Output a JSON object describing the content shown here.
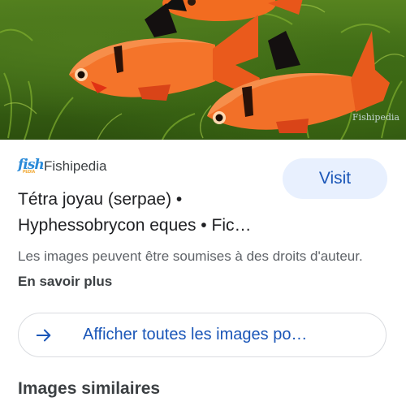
{
  "hero_image": {
    "subject": "tetra-fish-photo",
    "watermark": "Fishipedia"
  },
  "source": {
    "logo_text": "fish",
    "logo_subtext": "PEDIA",
    "name": "Fishipedia"
  },
  "visit_button": {
    "label": "Visit"
  },
  "result": {
    "title_line1": "Tétra joyau (serpae) •",
    "title_line2": "Hyphessobrycon eques • Fic…"
  },
  "notice": {
    "text": "Les images peuvent être soumises à des droits d'auteur.",
    "link": "En savoir plus"
  },
  "show_all": {
    "label": "Afficher toutes les images po…",
    "icon": "arrow-right-icon"
  },
  "similar": {
    "heading": "Images similaires"
  },
  "colors": {
    "accent": "#1a56b8",
    "visit_bg": "#e8f0fe",
    "fish_orange": "#f06a1e"
  }
}
